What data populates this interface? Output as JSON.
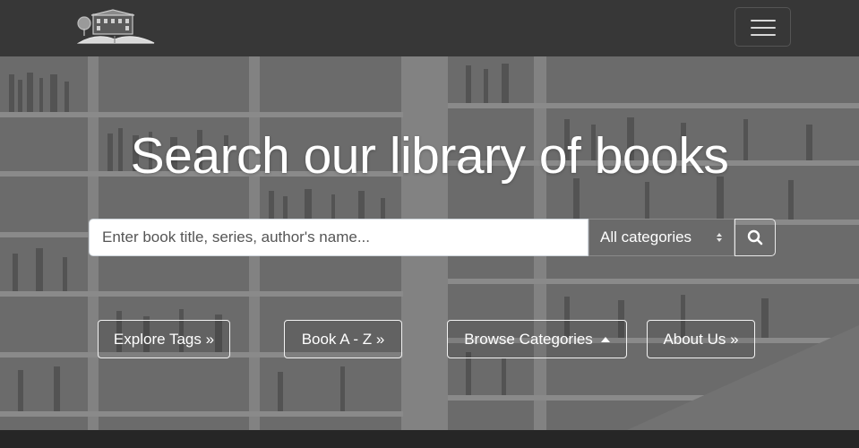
{
  "navbar": {
    "logo_icon": "library-building-open-book-logo",
    "menu_icon": "hamburger-icon"
  },
  "hero": {
    "title": "Search our library of books",
    "background": "bookshelves-photo-grayscale"
  },
  "search": {
    "placeholder": "Enter book title, series, author's name...",
    "category_selected": "All categories",
    "button_icon": "search-icon"
  },
  "buttons": {
    "explore_tags": "Explore Tags »",
    "book_az": "Book A - Z »",
    "browse_categories": "Browse Categories",
    "about_us": "About Us »"
  },
  "colors": {
    "navbar": "#373737",
    "footer": "#262626",
    "text": "#ffffff"
  }
}
